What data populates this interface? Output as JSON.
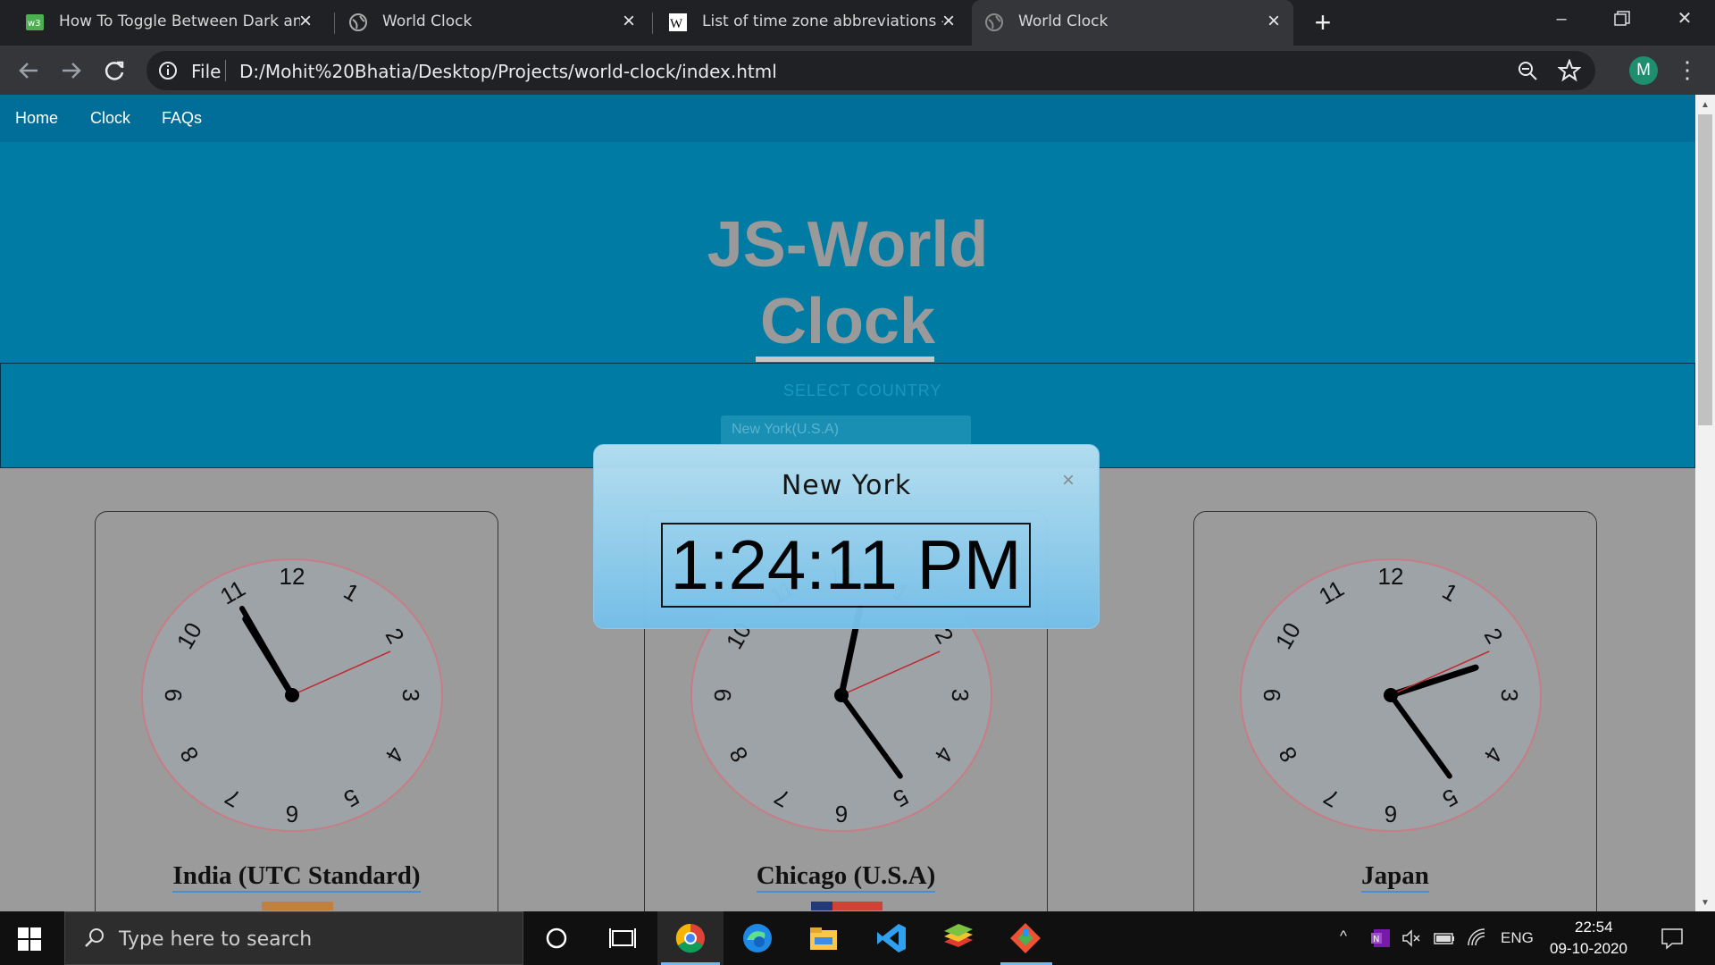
{
  "tabs": [
    {
      "title": "How To Toggle Between Dark and Light Mode"
    },
    {
      "title": "World Clock"
    },
    {
      "title": "List of time zone abbreviations - Wikipedia"
    },
    {
      "title": "World Clock"
    }
  ],
  "address": {
    "scheme_label": "File",
    "url": "D:/Mohit%20Bhatia/Desktop/Projects/world-clock/index.html"
  },
  "profile_initial": "M",
  "site_nav": [
    "Home",
    "Clock",
    "FAQs"
  ],
  "hero": {
    "title": "JS-World Clock"
  },
  "selector": {
    "label": "SELECT COUNTRY",
    "value": "New York(U.S.A)"
  },
  "clocks": [
    {
      "label": "India (UTC Standard)",
      "hour": 10.95,
      "minute": 55,
      "second": 11
    },
    {
      "label": "Chicago (U.S.A)",
      "hour": 12.4,
      "minute": 24,
      "second": 11
    },
    {
      "label": "Japan",
      "hour": 2.4,
      "minute": 24,
      "second": 11
    }
  ],
  "dial_numbers": [
    "12",
    "1",
    "2",
    "3",
    "4",
    "5",
    "6",
    "7",
    "8",
    "9",
    "10",
    "11"
  ],
  "modal": {
    "title": "New York",
    "time": "1:24:11 PM",
    "close": "×"
  },
  "taskbar": {
    "search_placeholder": "Type here to search",
    "lang": "ENG",
    "time": "22:54",
    "date": "09-10-2020"
  }
}
